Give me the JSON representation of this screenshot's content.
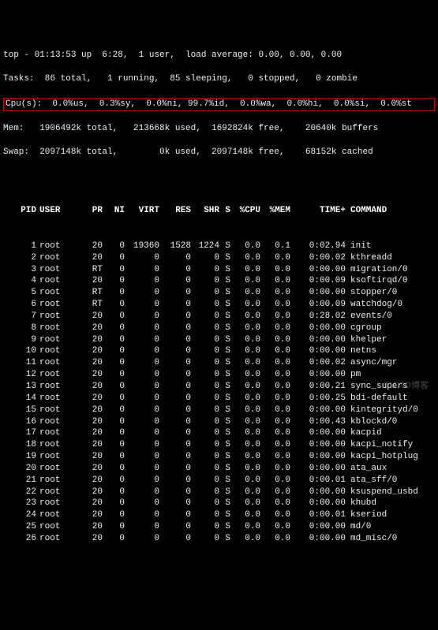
{
  "summary": {
    "line1": "top - 01:13:53 up  6:28,  1 user,  load average: 0.00, 0.00, 0.00",
    "line2": "Tasks:  86 total,   1 running,  85 sleeping,   0 stopped,   0 zombie",
    "line3": "Cpu(s):  0.0%us,  0.3%sy,  0.0%ni, 99.7%id,  0.0%wa,  0.0%hi,  0.0%si,  0.0%st",
    "line4": "Mem:   1906492k total,   213668k used,  1692824k free,    20640k buffers",
    "line5": "Swap:  2097148k total,        0k used,  2097148k free,    68152k cached"
  },
  "columns": {
    "pid": "PID",
    "user": "USER",
    "pr": "PR",
    "ni": "NI",
    "virt": "VIRT",
    "res": "RES",
    "shr": "SHR",
    "s": "S",
    "cpu": "%CPU",
    "mem": "%MEM",
    "time": "TIME+",
    "cmd": "COMMAND"
  },
  "rows": [
    {
      "pid": "1",
      "user": "root",
      "pr": "20",
      "ni": "0",
      "virt": "19360",
      "res": "1528",
      "shr": "1224",
      "s": "S",
      "cpu": "0.0",
      "mem": "0.1",
      "time": "0:02.94",
      "cmd": "init"
    },
    {
      "pid": "2",
      "user": "root",
      "pr": "20",
      "ni": "0",
      "virt": "0",
      "res": "0",
      "shr": "0",
      "s": "S",
      "cpu": "0.0",
      "mem": "0.0",
      "time": "0:00.02",
      "cmd": "kthreadd"
    },
    {
      "pid": "3",
      "user": "root",
      "pr": "RT",
      "ni": "0",
      "virt": "0",
      "res": "0",
      "shr": "0",
      "s": "S",
      "cpu": "0.0",
      "mem": "0.0",
      "time": "0:00.00",
      "cmd": "migration/0"
    },
    {
      "pid": "4",
      "user": "root",
      "pr": "20",
      "ni": "0",
      "virt": "0",
      "res": "0",
      "shr": "0",
      "s": "S",
      "cpu": "0.0",
      "mem": "0.0",
      "time": "0:00.09",
      "cmd": "ksoftirqd/0"
    },
    {
      "pid": "5",
      "user": "root",
      "pr": "RT",
      "ni": "0",
      "virt": "0",
      "res": "0",
      "shr": "0",
      "s": "S",
      "cpu": "0.0",
      "mem": "0.0",
      "time": "0:00.00",
      "cmd": "stopper/0"
    },
    {
      "pid": "6",
      "user": "root",
      "pr": "RT",
      "ni": "0",
      "virt": "0",
      "res": "0",
      "shr": "0",
      "s": "S",
      "cpu": "0.0",
      "mem": "0.0",
      "time": "0:00.09",
      "cmd": "watchdog/0"
    },
    {
      "pid": "7",
      "user": "root",
      "pr": "20",
      "ni": "0",
      "virt": "0",
      "res": "0",
      "shr": "0",
      "s": "S",
      "cpu": "0.0",
      "mem": "0.0",
      "time": "0:28.02",
      "cmd": "events/0"
    },
    {
      "pid": "8",
      "user": "root",
      "pr": "20",
      "ni": "0",
      "virt": "0",
      "res": "0",
      "shr": "0",
      "s": "S",
      "cpu": "0.0",
      "mem": "0.0",
      "time": "0:00.00",
      "cmd": "cgroup"
    },
    {
      "pid": "9",
      "user": "root",
      "pr": "20",
      "ni": "0",
      "virt": "0",
      "res": "0",
      "shr": "0",
      "s": "S",
      "cpu": "0.0",
      "mem": "0.0",
      "time": "0:00.00",
      "cmd": "khelper"
    },
    {
      "pid": "10",
      "user": "root",
      "pr": "20",
      "ni": "0",
      "virt": "0",
      "res": "0",
      "shr": "0",
      "s": "S",
      "cpu": "0.0",
      "mem": "0.0",
      "time": "0:00.00",
      "cmd": "netns"
    },
    {
      "pid": "11",
      "user": "root",
      "pr": "20",
      "ni": "0",
      "virt": "0",
      "res": "0",
      "shr": "0",
      "s": "S",
      "cpu": "0.0",
      "mem": "0.0",
      "time": "0:00.02",
      "cmd": "async/mgr"
    },
    {
      "pid": "12",
      "user": "root",
      "pr": "20",
      "ni": "0",
      "virt": "0",
      "res": "0",
      "shr": "0",
      "s": "S",
      "cpu": "0.0",
      "mem": "0.0",
      "time": "0:00.00",
      "cmd": "pm"
    },
    {
      "pid": "13",
      "user": "root",
      "pr": "20",
      "ni": "0",
      "virt": "0",
      "res": "0",
      "shr": "0",
      "s": "S",
      "cpu": "0.0",
      "mem": "0.0",
      "time": "0:00.21",
      "cmd": "sync_supers"
    },
    {
      "pid": "14",
      "user": "root",
      "pr": "20",
      "ni": "0",
      "virt": "0",
      "res": "0",
      "shr": "0",
      "s": "S",
      "cpu": "0.0",
      "mem": "0.0",
      "time": "0:00.25",
      "cmd": "bdi-default"
    },
    {
      "pid": "15",
      "user": "root",
      "pr": "20",
      "ni": "0",
      "virt": "0",
      "res": "0",
      "shr": "0",
      "s": "S",
      "cpu": "0.0",
      "mem": "0.0",
      "time": "0:00.00",
      "cmd": "kintegrityd/0"
    },
    {
      "pid": "16",
      "user": "root",
      "pr": "20",
      "ni": "0",
      "virt": "0",
      "res": "0",
      "shr": "0",
      "s": "S",
      "cpu": "0.0",
      "mem": "0.0",
      "time": "0:00.43",
      "cmd": "kblockd/0"
    },
    {
      "pid": "17",
      "user": "root",
      "pr": "20",
      "ni": "0",
      "virt": "0",
      "res": "0",
      "shr": "0",
      "s": "S",
      "cpu": "0.0",
      "mem": "0.0",
      "time": "0:00.00",
      "cmd": "kacpid"
    },
    {
      "pid": "18",
      "user": "root",
      "pr": "20",
      "ni": "0",
      "virt": "0",
      "res": "0",
      "shr": "0",
      "s": "S",
      "cpu": "0.0",
      "mem": "0.0",
      "time": "0:00.00",
      "cmd": "kacpi_notify"
    },
    {
      "pid": "19",
      "user": "root",
      "pr": "20",
      "ni": "0",
      "virt": "0",
      "res": "0",
      "shr": "0",
      "s": "S",
      "cpu": "0.0",
      "mem": "0.0",
      "time": "0:00.00",
      "cmd": "kacpi_hotplug"
    },
    {
      "pid": "20",
      "user": "root",
      "pr": "20",
      "ni": "0",
      "virt": "0",
      "res": "0",
      "shr": "0",
      "s": "S",
      "cpu": "0.0",
      "mem": "0.0",
      "time": "0:00.00",
      "cmd": "ata_aux"
    },
    {
      "pid": "21",
      "user": "root",
      "pr": "20",
      "ni": "0",
      "virt": "0",
      "res": "0",
      "shr": "0",
      "s": "S",
      "cpu": "0.0",
      "mem": "0.0",
      "time": "0:00.01",
      "cmd": "ata_sff/0"
    },
    {
      "pid": "22",
      "user": "root",
      "pr": "20",
      "ni": "0",
      "virt": "0",
      "res": "0",
      "shr": "0",
      "s": "S",
      "cpu": "0.0",
      "mem": "0.0",
      "time": "0:00.00",
      "cmd": "ksuspend_usbd"
    },
    {
      "pid": "23",
      "user": "root",
      "pr": "20",
      "ni": "0",
      "virt": "0",
      "res": "0",
      "shr": "0",
      "s": "S",
      "cpu": "0.0",
      "mem": "0.0",
      "time": "0:00.00",
      "cmd": "khubd"
    },
    {
      "pid": "24",
      "user": "root",
      "pr": "20",
      "ni": "0",
      "virt": "0",
      "res": "0",
      "shr": "0",
      "s": "S",
      "cpu": "0.0",
      "mem": "0.0",
      "time": "0:00.01",
      "cmd": "kseriod"
    },
    {
      "pid": "25",
      "user": "root",
      "pr": "20",
      "ni": "0",
      "virt": "0",
      "res": "0",
      "shr": "0",
      "s": "S",
      "cpu": "0.0",
      "mem": "0.0",
      "time": "0:00.00",
      "cmd": "md/0"
    },
    {
      "pid": "26",
      "user": "root",
      "pr": "20",
      "ni": "0",
      "virt": "0",
      "res": "0",
      "shr": "0",
      "s": "S",
      "cpu": "0.0",
      "mem": "0.0",
      "time": "0:00.00",
      "cmd": "md_misc/0"
    }
  ],
  "watermark": "51CTO博客"
}
